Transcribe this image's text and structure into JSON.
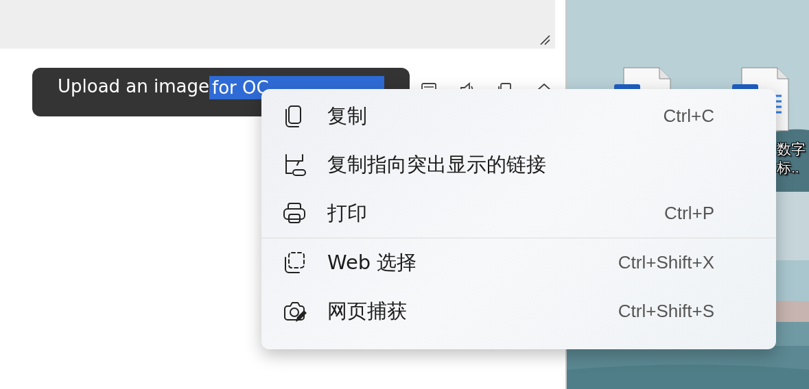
{
  "tooltip": {
    "text": "Upload an image",
    "selected_text": "for OC"
  },
  "desktop": {
    "icons": [
      {
        "kind": "blank"
      },
      {
        "kind": "text",
        "label": [
          "数字",
          "标.."
        ]
      }
    ]
  },
  "context_menu": {
    "groups": [
      [
        {
          "kind": "copy",
          "label": "复制",
          "shortcut": "Ctrl+C"
        },
        {
          "kind": "copy-link",
          "label": "复制指向突出显示的链接"
        },
        {
          "kind": "print",
          "label": "打印",
          "shortcut": "Ctrl+P"
        }
      ],
      [
        {
          "kind": "web-select",
          "label": "Web 选择",
          "shortcut": "Ctrl+Shift+X"
        },
        {
          "kind": "capture",
          "label": "网页捕获",
          "shortcut": "Ctrl+Shift+S"
        }
      ]
    ]
  }
}
